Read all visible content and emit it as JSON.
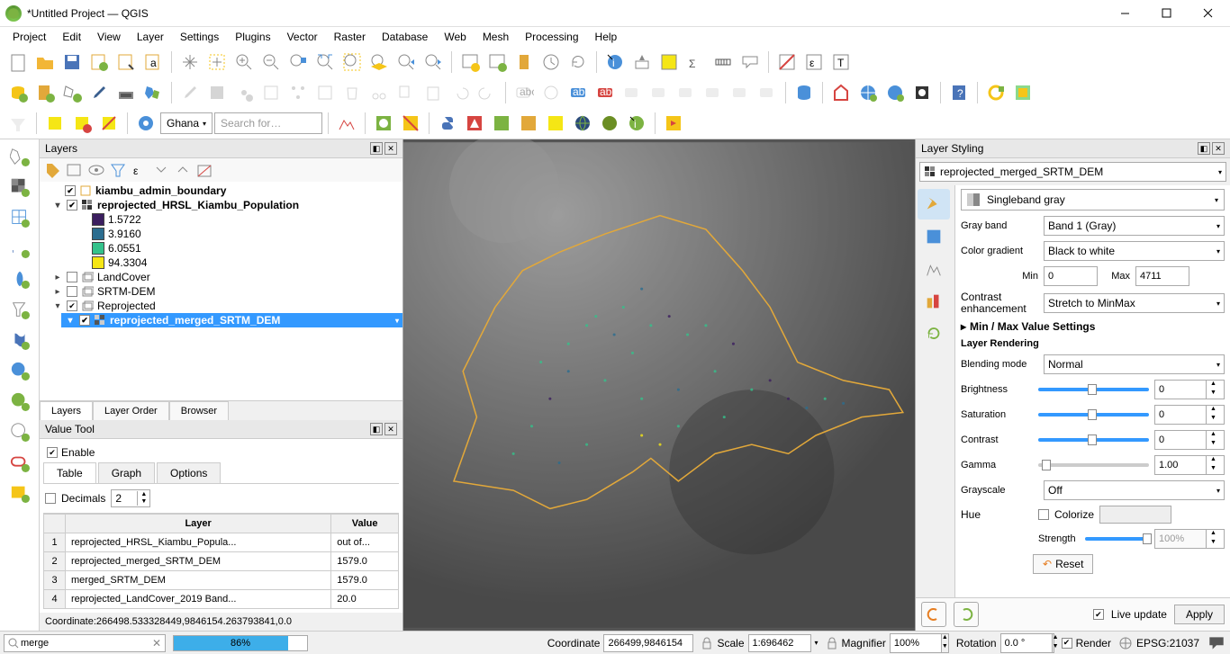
{
  "title": "*Untitled Project — QGIS",
  "menus": [
    "Project",
    "Edit",
    "View",
    "Layer",
    "Settings",
    "Plugins",
    "Vector",
    "Raster",
    "Database",
    "Web",
    "Mesh",
    "Processing",
    "Help"
  ],
  "nominatim": {
    "country": "Ghana",
    "placeholder": "Search for…"
  },
  "layersPanel": {
    "title": "Layers",
    "tabs": [
      "Layers",
      "Layer Order",
      "Browser"
    ],
    "tree": {
      "kiambu": "kiambu_admin_boundary",
      "hrsl": "reprojected_HRSL_Kiambu_Population",
      "legend": [
        {
          "label": "1.5722",
          "color": "#3b1e5f"
        },
        {
          "label": "3.9160",
          "color": "#2b6d8f"
        },
        {
          "label": "6.0551",
          "color": "#34c28b"
        },
        {
          "label": "94.3304",
          "color": "#f5e615"
        }
      ],
      "landcover": "LandCover",
      "srtm": "SRTM-DEM",
      "reprojected": "Reprojected",
      "selected": "reprojected_merged_SRTM_DEM"
    }
  },
  "valueTool": {
    "title": "Value Tool",
    "enable": "Enable",
    "tabs": [
      "Table",
      "Graph",
      "Options"
    ],
    "decimalsLabel": "Decimals",
    "decimals": "2",
    "headers": [
      "",
      "Layer",
      "Value"
    ],
    "rows": [
      {
        "n": "1",
        "layer": "reprojected_HRSL_Kiambu_Popula...",
        "value": "out of..."
      },
      {
        "n": "2",
        "layer": "reprojected_merged_SRTM_DEM",
        "value": "1579.0"
      },
      {
        "n": "3",
        "layer": "merged_SRTM_DEM",
        "value": "1579.0"
      },
      {
        "n": "4",
        "layer": "reprojected_LandCover_2019 Band...",
        "value": "20.0"
      }
    ]
  },
  "coordText": "Coordinate:266498.533328449,9846154.263793841,0.0",
  "styling": {
    "title": "Layer Styling",
    "layerCombo": "reprojected_merged_SRTM_DEM",
    "renderer": "Singleband gray",
    "grayband_label": "Gray band",
    "grayband": "Band 1 (Gray)",
    "colorgrad_label": "Color gradient",
    "colorgrad": "Black to white",
    "min_label": "Min",
    "min": "0",
    "max_label": "Max",
    "max": "4711",
    "contrast_label": "Contrast enhancement",
    "contrast": "Stretch to MinMax",
    "minmaxHeader": "Min / Max Value Settings",
    "renderingHeader": "Layer Rendering",
    "blending_label": "Blending mode",
    "blending": "Normal",
    "brightness_label": "Brightness",
    "brightness": "0",
    "saturation_label": "Saturation",
    "saturation": "0",
    "contrast2_label": "Contrast",
    "contrast2": "0",
    "gamma_label": "Gamma",
    "gamma": "1.00",
    "grayscale_label": "Grayscale",
    "grayscale": "Off",
    "hue_label": "Hue",
    "colorize": "Colorize",
    "strength_label": "Strength",
    "strength": "100%",
    "reset": "Reset",
    "liveUpdate": "Live update",
    "apply": "Apply"
  },
  "status": {
    "search": "merge",
    "progress": "86%",
    "coord_label": "Coordinate",
    "coordinate": "266499,9846154",
    "scale_label": "Scale",
    "scale": "1:696462",
    "magnifier_label": "Magnifier",
    "magnifier": "100%",
    "rotation_label": "Rotation",
    "rotation": "0.0 °",
    "render": "Render",
    "epsg": "EPSG:21037"
  }
}
